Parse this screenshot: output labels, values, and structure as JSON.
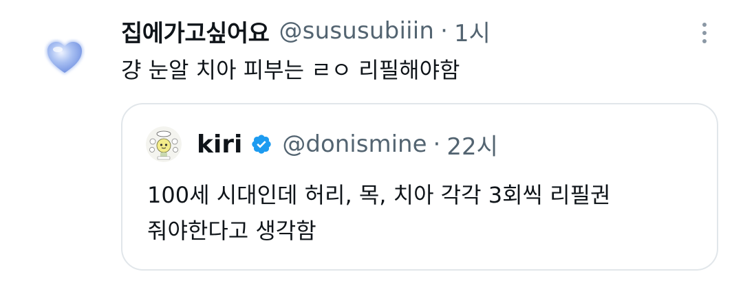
{
  "reply": {
    "avatar_icon": "blue-heart-icon",
    "display_name": "집에가고싶어요",
    "handle": "@sususubiiin",
    "separator": "·",
    "time": "1시",
    "more_icon": "more-options-icon",
    "text": "걍 눈알 치아 피부는 ㄹㅇ 리필해야함"
  },
  "quote": {
    "avatar_icon": "cartoon-avatar-icon",
    "display_name": "kiri",
    "verified_icon": "verified-badge-icon",
    "handle": "@donismine",
    "separator": "·",
    "time": "22시",
    "text_lines": [
      "100세 시대인데 허리, 목, 치아 각각 3회씩 리필권",
      "줘야한다고 생각함"
    ]
  },
  "colors": {
    "text_primary": "#0f1419",
    "text_secondary": "#536471",
    "verified_blue": "#1d9bf0",
    "border": "#e1e6ea",
    "heart_blue": "#7f9fe6"
  }
}
